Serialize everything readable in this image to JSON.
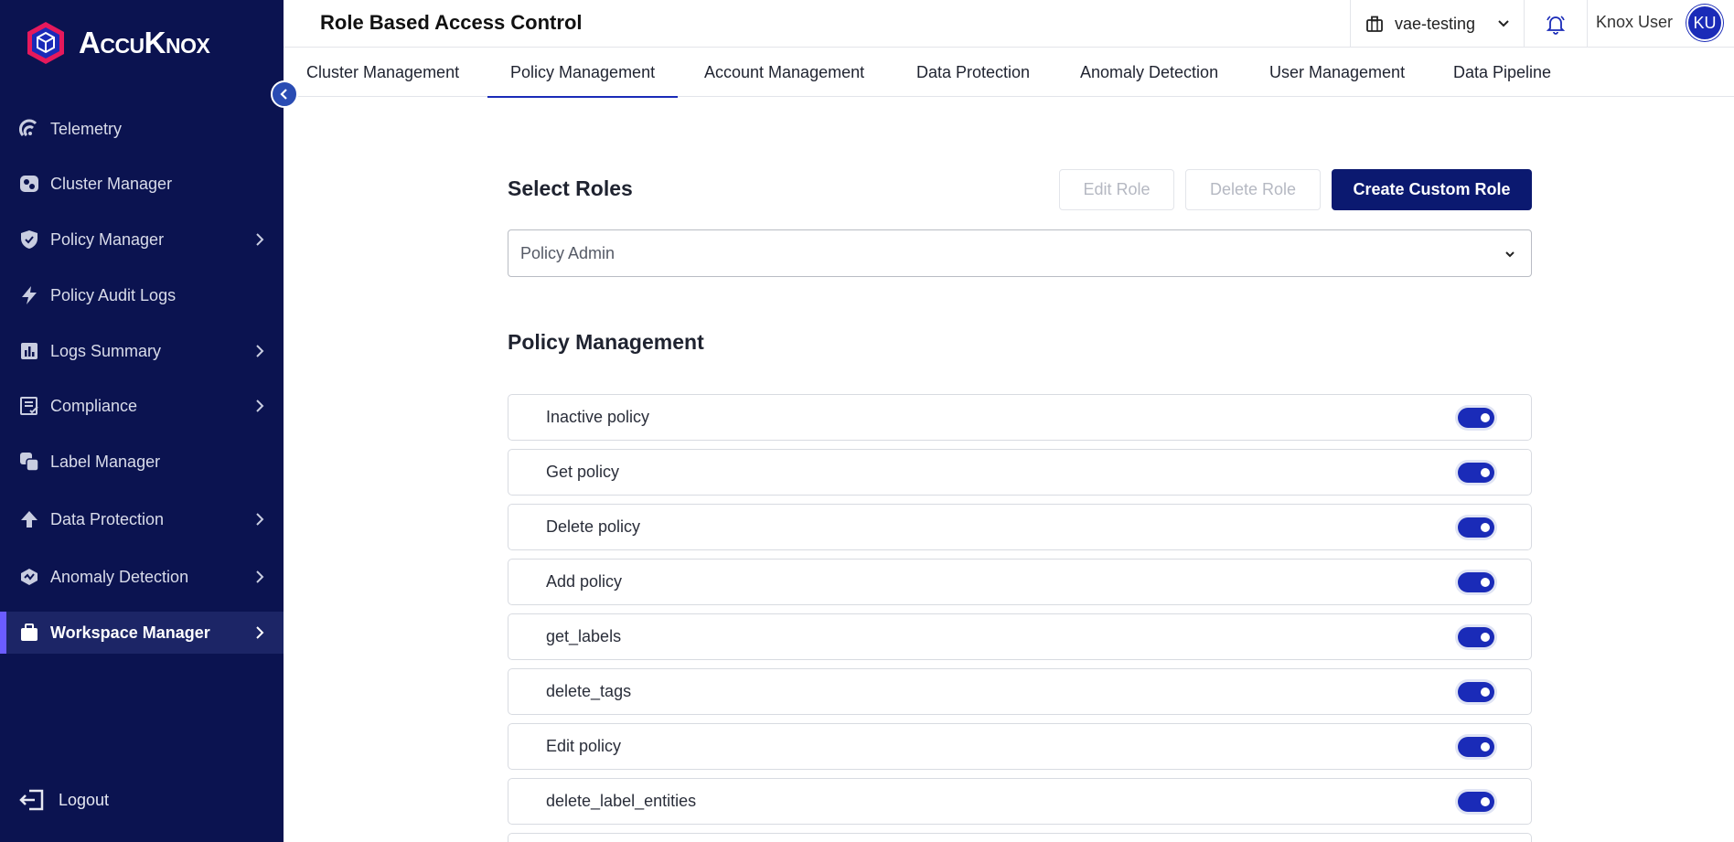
{
  "app": {
    "brand": "AccuKnox",
    "colors": {
      "sidebar_bg": "#0b1350",
      "primary": "#0b1970",
      "accent": "#1a2bb8",
      "active_marker": "#6b5cff"
    }
  },
  "sidebar": {
    "items": [
      {
        "label": "Telemetry",
        "icon": "telemetry-icon",
        "has_children": false
      },
      {
        "label": "Cluster Manager",
        "icon": "cluster-icon",
        "has_children": false
      },
      {
        "label": "Policy Manager",
        "icon": "shield-icon",
        "has_children": true
      },
      {
        "label": "Policy Audit Logs",
        "icon": "lightning-icon",
        "has_children": false
      },
      {
        "label": "Logs Summary",
        "icon": "bar-chart-icon",
        "has_children": true
      },
      {
        "label": "Compliance",
        "icon": "checklist-icon",
        "has_children": true
      },
      {
        "label": "Label Manager",
        "icon": "label-icon",
        "has_children": false
      },
      {
        "label": "Data Protection",
        "icon": "data-protection-icon",
        "has_children": true
      },
      {
        "label": "Anomaly Detection",
        "icon": "anomaly-icon",
        "has_children": true
      },
      {
        "label": "Workspace Manager",
        "icon": "briefcase-icon",
        "has_children": true,
        "active": true
      }
    ],
    "logout_label": "Logout"
  },
  "header": {
    "title": "Role Based Access Control",
    "workspace": "vae-testing",
    "user_name": "Knox User",
    "user_initials": "KU"
  },
  "tabs": [
    {
      "label": "Cluster Management"
    },
    {
      "label": "Policy Management",
      "active": true
    },
    {
      "label": "Account Management"
    },
    {
      "label": "Data Protection"
    },
    {
      "label": "Anomaly Detection"
    },
    {
      "label": "User Management"
    },
    {
      "label": "Data Pipeline"
    }
  ],
  "main": {
    "select_roles_title": "Select Roles",
    "edit_role_label": "Edit Role",
    "delete_role_label": "Delete Role",
    "create_role_label": "Create Custom Role",
    "selected_role": "Policy Admin",
    "permissions_title": "Policy Management",
    "permissions": [
      {
        "label": "Inactive policy",
        "enabled": true
      },
      {
        "label": "Get policy",
        "enabled": true
      },
      {
        "label": "Delete policy",
        "enabled": true
      },
      {
        "label": "Add policy",
        "enabled": true
      },
      {
        "label": "get_labels",
        "enabled": true
      },
      {
        "label": "delete_tags",
        "enabled": true
      },
      {
        "label": "Edit policy",
        "enabled": true
      },
      {
        "label": "delete_label_entities",
        "enabled": true
      }
    ]
  }
}
